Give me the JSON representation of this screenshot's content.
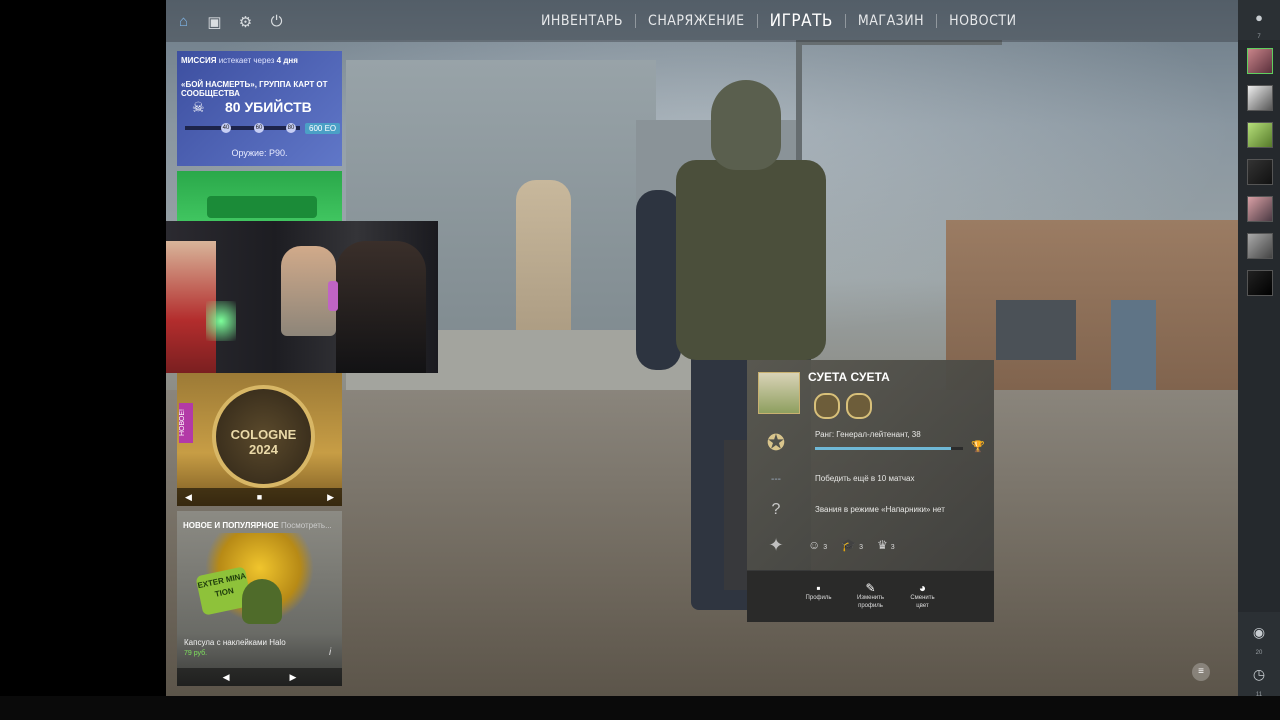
{
  "nav": {
    "items": [
      "ИНВЕНТАРЬ",
      "СНАРЯЖЕНИЕ",
      "ИГРАТЬ",
      "МАГАЗИН",
      "НОВОСТИ"
    ],
    "icons": [
      "home-icon",
      "tv-icon",
      "gear-icon",
      "power-icon"
    ]
  },
  "mission": {
    "label": "МИССИЯ",
    "expires_prefix": "истекает через",
    "expires": "4 дня",
    "subtitle": "«БОЙ НАСМЕРТЬ», ГРУППА КАРТ ОТ СООБЩЕСТВА",
    "goal": "80 УБИЙСТВ",
    "checkpoints": [
      "40",
      "60",
      "80"
    ],
    "xp": "600 ЕО",
    "weapon": "Оружие: P90.",
    "progress_fraction": 0.0
  },
  "sticker_card": {
    "badge": "НОВОЕ!",
    "art_text": "COLOGNE 2024",
    "prev": "◀",
    "next": "▶"
  },
  "capsule_card": {
    "heading": "НОВОЕ И ПОПУЛЯРНОЕ",
    "heading_more": "Посмотреть...",
    "badge_text": "EXTER MINA TION",
    "name": "Капсула с наклейками Halo",
    "price": "79 руб.",
    "info": "i",
    "prev": "◀",
    "next": "▶"
  },
  "profile": {
    "name": "СУЕТА СУЕТА",
    "rank": "Ранг: Генерал-лейтенант, 38",
    "rank_progress": 0.92,
    "wins_text": "Победить ещё в 10 матчах",
    "wins_placeholder": "---",
    "wingman_text": "Звания в режиме «Напарники» нет",
    "stats": [
      {
        "icon": "smile-icon",
        "value": "3"
      },
      {
        "icon": "teacher-icon",
        "value": "3"
      },
      {
        "icon": "crown-icon",
        "value": "3"
      }
    ],
    "actions": [
      {
        "icon": "profile-icon",
        "label": "Профиль"
      },
      {
        "icon": "edit-icon",
        "label": "Изменить профиль"
      },
      {
        "icon": "palette-icon",
        "label": "Сменить цвет"
      }
    ]
  },
  "sidebar": {
    "top_count": "7",
    "bottom": [
      {
        "icon": "broadcast-icon",
        "value": "20"
      },
      {
        "icon": "history-icon",
        "value": "11"
      }
    ]
  },
  "colors": {
    "accent": "#7fb4e6",
    "mission_bg": "#4e64b4",
    "xp_bar": "#6fb8d6",
    "online": "#5fcf5f"
  }
}
